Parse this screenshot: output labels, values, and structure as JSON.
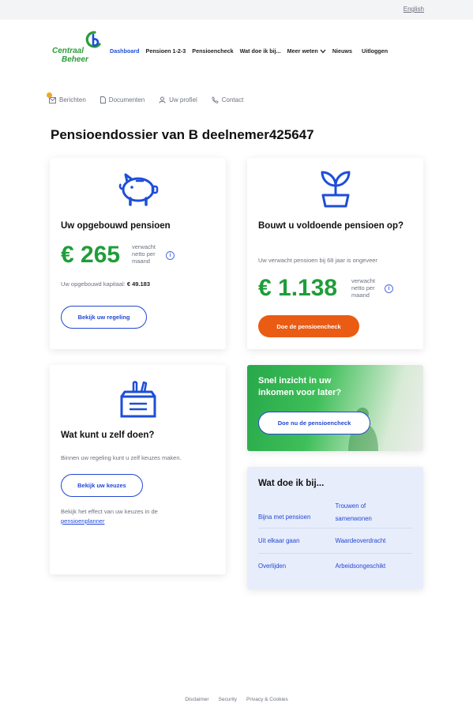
{
  "topbar": {
    "language_link": "English"
  },
  "logo": {
    "line1": "Centraal",
    "line2": "Beheer"
  },
  "nav": [
    {
      "label": "Dashboard",
      "active": true
    },
    {
      "label": "Pensioen 1-2-3",
      "active": false
    },
    {
      "label": "Pensioencheck",
      "active": false
    },
    {
      "label": "Wat doe ik bij...",
      "active": false
    },
    {
      "label": "Meer weten",
      "active": false,
      "dropdown": true
    },
    {
      "label": "Nieuws",
      "active": false
    },
    {
      "label": "Uitloggen",
      "active": false
    }
  ],
  "subnav": {
    "messages": "Berichten",
    "documents": "Documenten",
    "profile": "Uw profiel",
    "contact": "Contact"
  },
  "page_title": "Pensioendossier van B deelnemer425647",
  "card_pension": {
    "title": "Uw opgebouwd pensioen",
    "amount": "€ 265",
    "amount_note": "verwacht netto per maand",
    "capital_label": "Uw opgebouwd kapitaal:",
    "capital_value": "€  49.183",
    "button": "Bekijk uw regeling",
    "icon": "piggy-bank-icon"
  },
  "card_enough": {
    "title": "Bouwt u voldoende pensioen op?",
    "subtitle": "Uw verwacht pensioen bij 68 jaar is ongeveer",
    "amount": "€ 1.138",
    "amount_note": "verwacht netto per maand",
    "button": "Doe de pensioencheck",
    "icon": "sprout-icon"
  },
  "card_self": {
    "title": "Wat kunt u zelf doen?",
    "text": "Binnen uw regeling kunt u zelf keuzes maken.",
    "button": "Bekijk uw keuzes",
    "effect_text": "Bekijk het effect van uw keuzes in de",
    "effect_link": "pensioenplanner",
    "icon": "toolbox-icon"
  },
  "card_promo": {
    "title": "Snel inzicht in uw inkomen voor later?",
    "button": "Doe nu de pensioencheck"
  },
  "card_events": {
    "title": "Wat doe ik bij...",
    "links": [
      [
        "Bijna met pensioen",
        "Trouwen of samenwonen"
      ],
      [
        "Uit elkaar gaan",
        "Waardeoverdracht"
      ],
      [
        "Overlijden",
        "Arbeidsongeschikt"
      ]
    ]
  },
  "footer": [
    "Disclaimer",
    "Security",
    "Privacy & Cookies"
  ],
  "colors": {
    "brand_green": "#1f9d3a",
    "link_blue": "#2347d6",
    "cta_orange": "#ea5b14",
    "notification": "#f5a623"
  }
}
